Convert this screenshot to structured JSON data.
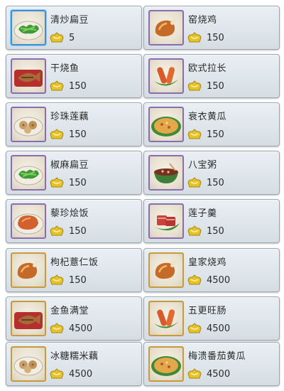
{
  "dishes": [
    {
      "name": "清炒扁豆",
      "price": "5",
      "icon": "green-beans-icon"
    },
    {
      "name": "窑烧鸡",
      "price": "150",
      "icon": "roast-chicken-icon"
    },
    {
      "name": "干烧鱼",
      "price": "150",
      "icon": "braised-fish-icon"
    },
    {
      "name": "欧式拉长",
      "price": "150",
      "icon": "sausage-icon"
    },
    {
      "name": "珍珠莲藕",
      "price": "150",
      "icon": "lotus-root-icon"
    },
    {
      "name": "衰衣黄瓜",
      "price": "150",
      "icon": "fried-rice-plate-icon"
    },
    {
      "name": "椒麻扁豆",
      "price": "150",
      "icon": "green-beans-icon"
    },
    {
      "name": "八宝粥",
      "price": "150",
      "icon": "porridge-bowl-icon"
    },
    {
      "name": "藜珍烩饭",
      "price": "150",
      "icon": "roast-chicken-plate-icon"
    },
    {
      "name": "莲子羹",
      "price": "150",
      "icon": "meat-on-leaf-icon"
    },
    {
      "name": "枸杞薏仁饭",
      "price": "150",
      "icon": "roast-chicken-icon"
    },
    {
      "name": "皇家烧鸡",
      "price": "4500",
      "icon": "roast-chicken-icon"
    },
    {
      "name": "金鱼满堂",
      "price": "4500",
      "icon": "braised-fish-icon"
    },
    {
      "name": "五更旺肠",
      "price": "4500",
      "icon": "sausage-icon"
    },
    {
      "name": "冰糖糯米藕",
      "price": "4500",
      "icon": "lotus-root-icon"
    },
    {
      "name": "梅溃番茄黄瓜",
      "price": "4500",
      "icon": "fried-rice-plate-icon"
    }
  ],
  "currency_icon": "gold-ingot-icon",
  "colors": {
    "card_bg": "#e3e9ee",
    "card_border": "#9aa7b2",
    "thumb_border": "#8a6db0",
    "selected_border": "#3b8fd6"
  }
}
